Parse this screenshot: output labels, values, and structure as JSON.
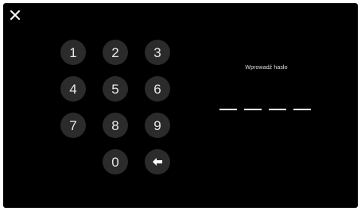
{
  "dialog": {
    "close_icon": "close-icon",
    "prompt": "Wprowadź hasło"
  },
  "keypad": {
    "keys": [
      "1",
      "2",
      "3",
      "4",
      "5",
      "6",
      "7",
      "8",
      "9",
      "0"
    ],
    "backspace_icon": "backspace-arrow-icon"
  },
  "pin": {
    "length": 4,
    "entered": 0
  },
  "colors": {
    "background": "#000000",
    "key_fill": "#2b2b2b",
    "key_text": "#e8e8e8",
    "dash": "#ffffff"
  }
}
